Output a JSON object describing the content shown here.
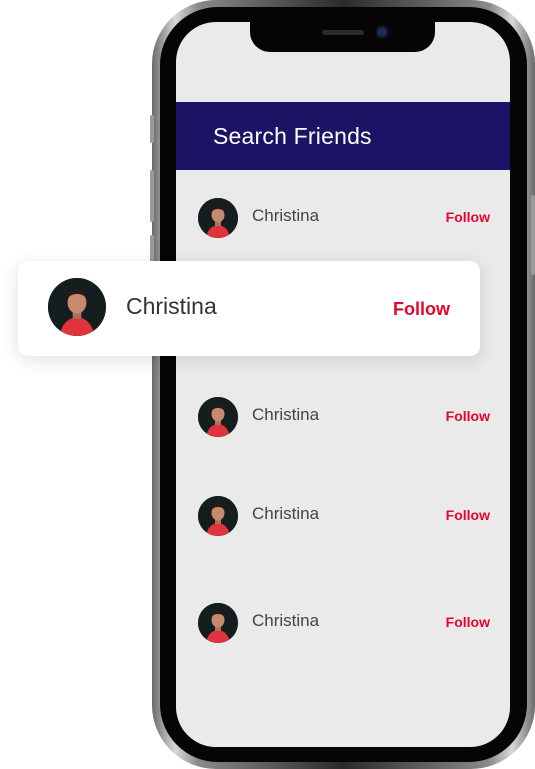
{
  "header": {
    "title": "Search Friends"
  },
  "friends": [
    {
      "name": "Christina",
      "action": "Follow"
    },
    {
      "name": "Christina",
      "action": "Follow"
    },
    {
      "name": "Christina",
      "action": "Follow"
    },
    {
      "name": "Christina",
      "action": "Follow"
    }
  ],
  "card": {
    "name": "Christina",
    "action": "Follow"
  },
  "colors": {
    "header_bg": "#1b1464",
    "accent": "#e4062e",
    "screen_bg": "#eaeaea"
  },
  "icons": {
    "avatar": "profile-photo-icon"
  }
}
